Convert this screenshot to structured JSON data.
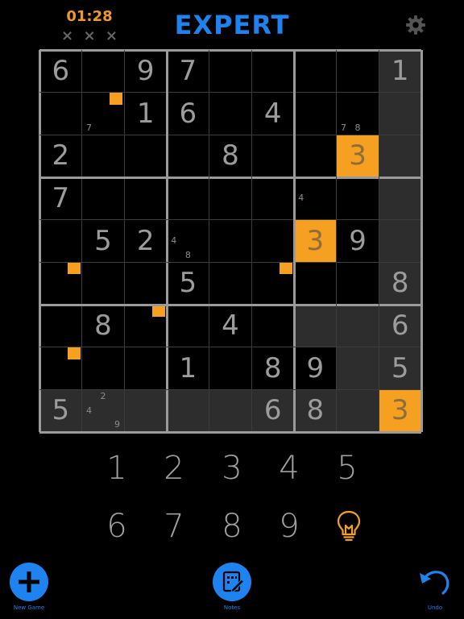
{
  "header": {
    "timer": "01:28",
    "strikes": [
      "×",
      "×",
      "×"
    ],
    "difficulty": "EXPERT",
    "settings_icon": "gear-icon"
  },
  "board": {
    "values": [
      [
        "6",
        "",
        "9",
        "7",
        "",
        "",
        "",
        "",
        "1"
      ],
      [
        "",
        "",
        "1",
        "6",
        "",
        "4",
        "",
        "",
        ""
      ],
      [
        "2",
        "",
        "",
        "",
        "8",
        "",
        "",
        "3",
        ""
      ],
      [
        "7",
        "",
        "",
        "",
        "",
        "",
        "",
        "",
        ""
      ],
      [
        "",
        "5",
        "2",
        "",
        "",
        "",
        "3",
        "9",
        ""
      ],
      [
        "",
        "",
        "",
        "5",
        "",
        "",
        "",
        "",
        "8"
      ],
      [
        "",
        "8",
        "",
        "",
        "4",
        "",
        "",
        "",
        "6"
      ],
      [
        "",
        "",
        "",
        "1",
        "",
        "8",
        "9",
        "",
        "5"
      ],
      [
        "5",
        "",
        "",
        "",
        "",
        "6",
        "8",
        "",
        "3"
      ]
    ],
    "highlighted": [
      [
        2,
        7
      ],
      [
        4,
        6
      ],
      [
        8,
        8
      ]
    ],
    "shaded": [
      [
        0,
        8
      ],
      [
        1,
        8
      ],
      [
        2,
        8
      ],
      [
        3,
        8
      ],
      [
        4,
        8
      ],
      [
        5,
        8
      ],
      [
        6,
        8
      ],
      [
        7,
        8
      ],
      [
        6,
        6
      ],
      [
        6,
        7
      ],
      [
        7,
        7
      ],
      [
        8,
        0
      ],
      [
        8,
        1
      ],
      [
        8,
        2
      ],
      [
        8,
        3
      ],
      [
        8,
        4
      ],
      [
        8,
        5
      ],
      [
        8,
        6
      ],
      [
        8,
        7
      ]
    ],
    "markers": [
      [
        1,
        1
      ],
      [
        5,
        0
      ],
      [
        5,
        5
      ],
      [
        6,
        2
      ],
      [
        7,
        0
      ]
    ],
    "notes": [
      {
        "cell": [
          1,
          1
        ],
        "digit": "7"
      },
      {
        "cell": [
          1,
          7
        ],
        "digit": "7"
      },
      {
        "cell": [
          1,
          7
        ],
        "digit": "8"
      },
      {
        "cell": [
          3,
          6
        ],
        "digit": "4"
      },
      {
        "cell": [
          4,
          3
        ],
        "digit": "4"
      },
      {
        "cell": [
          4,
          3
        ],
        "digit": "8"
      },
      {
        "cell": [
          8,
          1
        ],
        "digit": "2"
      },
      {
        "cell": [
          8,
          1
        ],
        "digit": "4"
      },
      {
        "cell": [
          8,
          1
        ],
        "digit": "9"
      }
    ]
  },
  "numpad": {
    "row1": [
      "1",
      "2",
      "3",
      "4",
      "5"
    ],
    "row2": [
      "6",
      "7",
      "8",
      "9"
    ],
    "hint_icon": "lightbulb-icon"
  },
  "footer": {
    "new_game_label": "New Game",
    "notes_label": "Notes",
    "undo_label": "Undo"
  },
  "colors": {
    "accent_blue": "#1e82ef",
    "highlight_orange": "#f5a021",
    "timer_orange": "#f2982b",
    "digit_gray": "#9c9c9c",
    "shade": "#2d2d2d"
  }
}
